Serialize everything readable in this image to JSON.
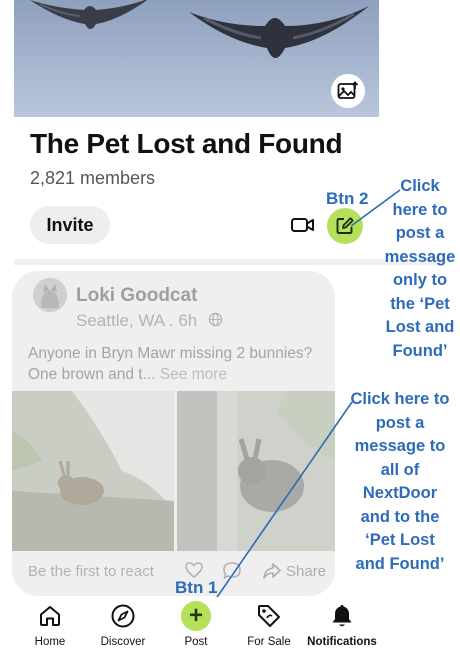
{
  "group": {
    "title": "The Pet Lost and Found",
    "members": "2,821 members",
    "invite_label": "Invite"
  },
  "post": {
    "author": "Loki Goodcat",
    "location": "Seattle, WA . 6h",
    "text": "Anyone in Bryn Mawr missing 2 bunnies? One brown and t...",
    "see_more": "See more",
    "reaction_prompt": "Be the first to react",
    "share_label": "Share"
  },
  "annotations": {
    "btn2_label": "Btn 2",
    "btn2_note": [
      "Click",
      "here to",
      "post a",
      "message",
      "only to",
      "the ‘Pet",
      "Lost and",
      "Found’"
    ],
    "btn1_label": "Btn 1",
    "btn1_note": [
      "Click here to",
      "post a",
      "message to",
      "all of",
      "NextDoor",
      "and to the",
      "‘Pet Lost",
      "and Found’"
    ]
  },
  "nav": {
    "items": [
      {
        "label": "Home",
        "icon": "home-icon"
      },
      {
        "label": "Discover",
        "icon": "compass-icon"
      },
      {
        "label": "Post",
        "icon": "plus-icon"
      },
      {
        "label": "For Sale",
        "icon": "price-tag-icon"
      },
      {
        "label": "Notifications",
        "icon": "bell-icon"
      }
    ]
  },
  "colors": {
    "accent_green": "#b7e05a",
    "annotation_blue": "#2e6bb8"
  }
}
